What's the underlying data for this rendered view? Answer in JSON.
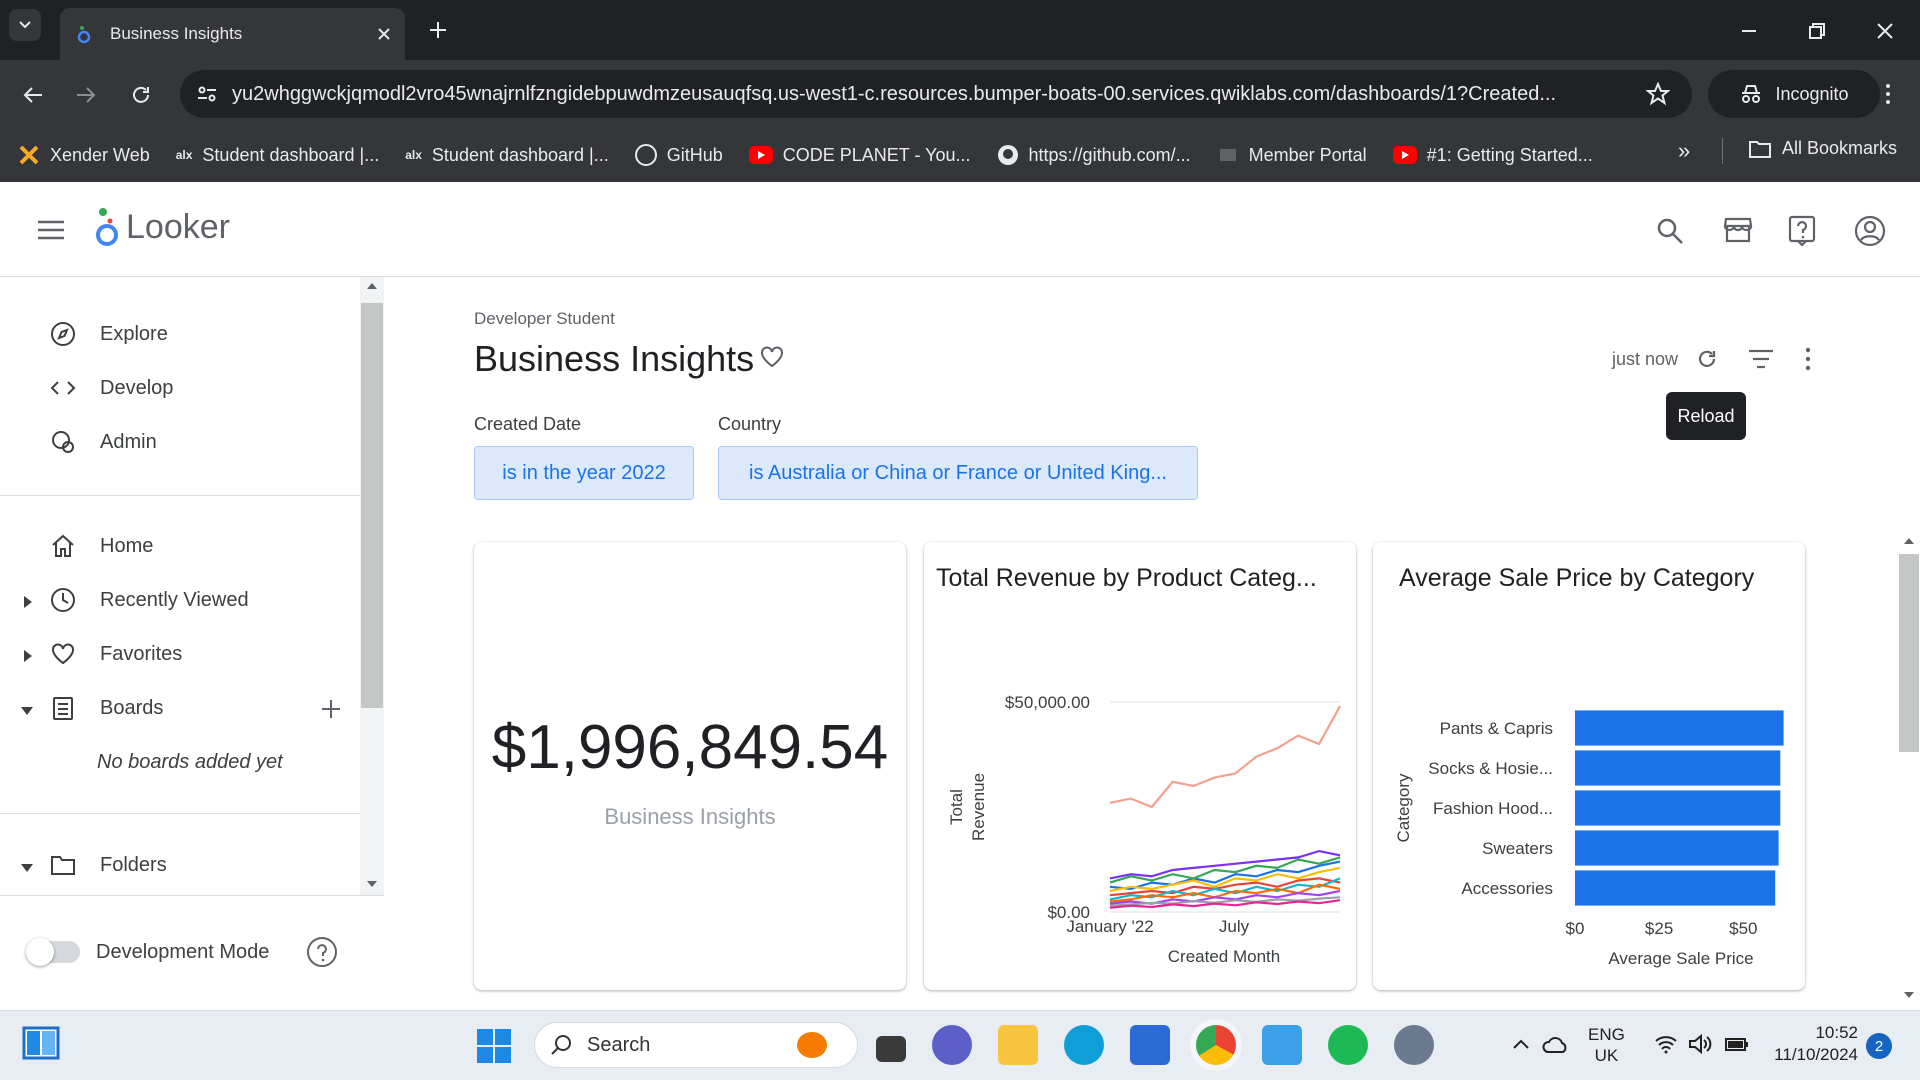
{
  "browser": {
    "tab_title": "Business Insights",
    "url": "yu2whggwckjqmodl2vro45wnajrnlfzngidebpuwdmzeusauqfsq.us-west1-c.resources.bumper-boats-00.services.qwiklabs.com/dashboards/1?Created...",
    "incognito_label": "Incognito",
    "bookmarks": [
      {
        "label": "Xender Web",
        "icon": "xender-icon"
      },
      {
        "label": "Student dashboard |...",
        "icon": "alx-icon"
      },
      {
        "label": "Student dashboard |...",
        "icon": "alx-icon"
      },
      {
        "label": "GitHub",
        "icon": "github-icon"
      },
      {
        "label": "CODE PLANET - You...",
        "icon": "youtube-icon"
      },
      {
        "label": "https://github.com/...",
        "icon": "github-icon"
      },
      {
        "label": "Member Portal",
        "icon": "portal-icon"
      },
      {
        "label": "#1: Getting Started...",
        "icon": "youtube-icon"
      }
    ],
    "all_bookmarks": "All Bookmarks"
  },
  "looker": {
    "logo_text": "Looker"
  },
  "sidebar": {
    "top_items": [
      {
        "label": "Explore",
        "icon": "compass-icon"
      },
      {
        "label": "Develop",
        "icon": "code-icon"
      },
      {
        "label": "Admin",
        "icon": "admin-icon"
      }
    ],
    "home": "Home",
    "recently_viewed": "Recently Viewed",
    "favorites": "Favorites",
    "boards": "Boards",
    "boards_empty": "No boards added yet",
    "folders": "Folders",
    "dev_mode": "Development Mode"
  },
  "dashboard": {
    "breadcrumb": "Developer Student",
    "title": "Business Insights",
    "updated": "just now",
    "tooltip": "Reload",
    "filters": [
      {
        "label": "Created Date",
        "value": "is in the year 2022"
      },
      {
        "label": "Country",
        "value": "is Australia or China or France or United King..."
      }
    ],
    "kpi": {
      "value": "$1,996,849.54",
      "label": "Business Insights"
    }
  },
  "chart_data": [
    {
      "type": "line",
      "title": "Total Revenue by Product Categ...",
      "xlabel": "Created Month",
      "ylabel": "Total Revenue",
      "yticks": [
        "$50,000.00",
        "$0.00"
      ],
      "xticks": [
        "January '22",
        "July"
      ],
      "ylim": [
        0,
        50000
      ],
      "x": [
        "2022-01",
        "2022-02",
        "2022-03",
        "2022-04",
        "2022-05",
        "2022-06",
        "2022-07",
        "2022-08",
        "2022-09",
        "2022-10",
        "2022-11",
        "2022-12"
      ],
      "series": [
        {
          "color": "#f4a08c",
          "values": [
            26000,
            27000,
            25000,
            31000,
            30000,
            32000,
            33000,
            37000,
            39000,
            42000,
            40000,
            49000
          ]
        },
        {
          "color": "#7b2ff7",
          "values": [
            8000,
            9000,
            8500,
            10000,
            10500,
            11000,
            11500,
            12000,
            12500,
            13000,
            14500,
            13500
          ]
        },
        {
          "color": "#1a73e8",
          "values": [
            6000,
            5500,
            7000,
            6500,
            8000,
            7000,
            9000,
            8500,
            10000,
            9500,
            11000,
            12000
          ]
        },
        {
          "color": "#34a853",
          "values": [
            7000,
            8500,
            7500,
            9000,
            8000,
            10000,
            9500,
            11000,
            10500,
            12500,
            11500,
            13000
          ]
        },
        {
          "color": "#fbbc04",
          "values": [
            5000,
            6000,
            5500,
            6500,
            7500,
            6000,
            8000,
            7500,
            9000,
            8000,
            9500,
            10500
          ]
        },
        {
          "color": "#ea4335",
          "values": [
            4000,
            4500,
            5000,
            4500,
            6000,
            5500,
            6500,
            7000,
            6000,
            7500,
            8000,
            7000
          ]
        },
        {
          "color": "#12b5cb",
          "values": [
            3000,
            4000,
            3500,
            5000,
            4000,
            5500,
            4500,
            6000,
            5000,
            6500,
            6000,
            8000
          ]
        },
        {
          "color": "#ff6d01",
          "values": [
            2500,
            3000,
            4000,
            3500,
            4500,
            3500,
            5000,
            4500,
            5500,
            4500,
            6500,
            5500
          ]
        },
        {
          "color": "#a142f4",
          "values": [
            2000,
            2500,
            2000,
            3000,
            2500,
            3500,
            3000,
            4000,
            3500,
            4500,
            4000,
            5000
          ]
        },
        {
          "color": "#9aa0a6",
          "values": [
            1500,
            1800,
            2200,
            2000,
            2600,
            2200,
            2800,
            2400,
            3000,
            2700,
            3200,
            3500
          ]
        },
        {
          "color": "#e52592",
          "values": [
            1000,
            1500,
            1200,
            1800,
            1400,
            2000,
            1600,
            2300,
            1900,
            2500,
            2100,
            2800
          ]
        }
      ]
    },
    {
      "type": "bar",
      "orientation": "horizontal",
      "title": "Average Sale Price by Category",
      "xlabel": "Average Sale Price",
      "ylabel": "Category",
      "categories": [
        "Pants & Capris",
        "Socks & Hosie...",
        "Fashion Hood...",
        "Sweaters",
        "Accessories"
      ],
      "values": [
        62,
        61,
        61,
        60.5,
        59.5
      ],
      "xticks": [
        "$0",
        "$25",
        "$50"
      ],
      "xlim": [
        0,
        63
      ],
      "color": "#1a73e8"
    }
  ],
  "taskbar": {
    "search_placeholder": "Search",
    "language": "ENG",
    "region": "UK",
    "time": "10:52",
    "date": "11/10/2024",
    "notifications": "2"
  }
}
